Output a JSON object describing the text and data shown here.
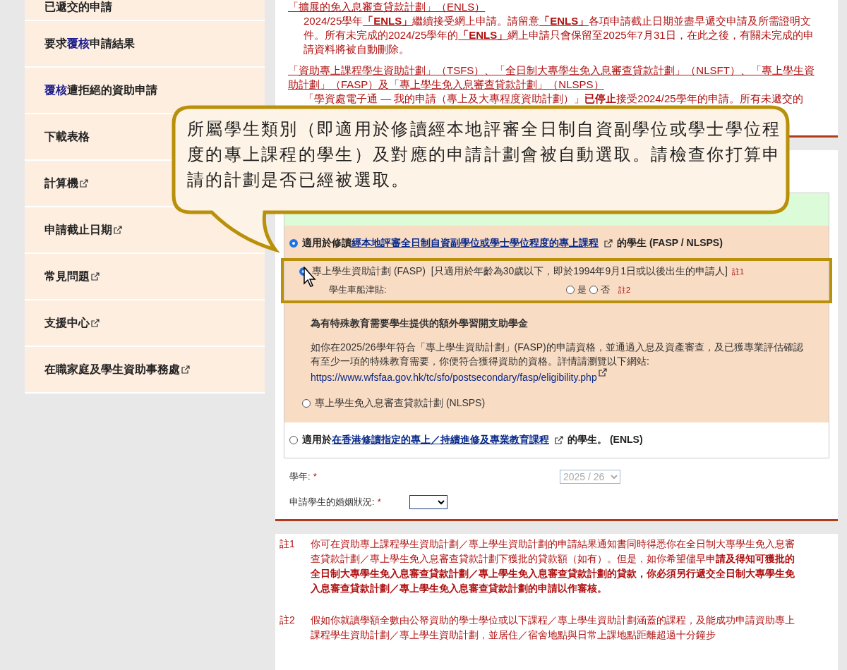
{
  "sidebar": {
    "items": [
      {
        "segments": [
          {
            "text": "已遞交的申請",
            "kind": "plain"
          }
        ],
        "external": false,
        "cut": true
      },
      {
        "segments": [
          {
            "text": "要求",
            "kind": "plain"
          },
          {
            "text": "覆核",
            "kind": "term"
          },
          {
            "text": "申請結果",
            "kind": "plain"
          }
        ],
        "external": false,
        "cut": false
      },
      {
        "segments": [
          {
            "text": "覆核",
            "kind": "term"
          },
          {
            "text": "遭拒絕的資助申請",
            "kind": "plain"
          }
        ],
        "external": false,
        "cut": false
      },
      {
        "segments": [
          {
            "text": "下載表格",
            "kind": "plain"
          }
        ],
        "external": false,
        "cut": false
      },
      {
        "segments": [
          {
            "text": "計算機",
            "kind": "plain"
          }
        ],
        "external": true,
        "cut": false
      },
      {
        "segments": [
          {
            "text": "申請截止日期",
            "kind": "plain"
          }
        ],
        "external": true,
        "cut": false
      },
      {
        "segments": [
          {
            "text": "常見問題",
            "kind": "plain"
          }
        ],
        "external": true,
        "cut": false
      },
      {
        "segments": [
          {
            "text": "支援中心",
            "kind": "plain"
          }
        ],
        "external": true,
        "cut": false
      },
      {
        "segments": [
          {
            "text": "在職家庭及學生資助事務處",
            "kind": "plain"
          }
        ],
        "external": true,
        "cut": false
      }
    ]
  },
  "notices": [
    {
      "heading": "「擴展的免入息審查貸款計劃」（ENLS）",
      "body": [
        {
          "text": "2024/25學年",
          "kind": "plain"
        },
        {
          "text": "「ENLS」",
          "kind": "link"
        },
        {
          "text": "繼續接受網上申請。請留意",
          "kind": "plain"
        },
        {
          "text": "「ENLS」",
          "kind": "link"
        },
        {
          "text": "各項申請截止日期並盡早遞交申請及所需證明文件。所有未完成的2024/25學年的",
          "kind": "plain"
        },
        {
          "text": "「ENLS」",
          "kind": "link"
        },
        {
          "text": "網上申請只會保留至2025年7月31日，在此之後，有關未完成的申請資料將被自動刪除。",
          "kind": "plain"
        }
      ]
    },
    {
      "heading": "「資助專上課程學生資助計劃」（TSFS）、「全日制大專學生免入息審查貸款計劃」（NLSFT）、「專上學生資助計劃」（FASP）及「專上學生免入息審查貸款計劃」（NLSPS）",
      "body": [
        {
          "text": "「學資處電子通 — 我的申請（專上及大專程度資助計劃）」",
          "kind": "plain"
        },
        {
          "text": "已停止",
          "kind": "bold"
        },
        {
          "text": "接受2024/25學年的申請。所有未遞交的",
          "kind": "plain"
        }
      ]
    }
  ],
  "callout": {
    "text": "所屬學生類別（即適用於修讀經本地評審全日制自資副學位或學士學位程度的專上課程的學生）及對應的申請計劃會被自動選取。請檢查你打算申請的計劃是否已經被選取。"
  },
  "categories": [
    {
      "selected": true,
      "prefix": "適用於修讀",
      "link": "經本地評審全日制自資副學位或學士學位程度的專上課程",
      "suffix": "的學生",
      "code": "(FASP / NLSPS)",
      "schemes": [
        {
          "selected": true,
          "highlighted": true,
          "label": "專上學生資助計劃 (FASP)",
          "condition": "[只適用於年齡為30歲以下，即於1994年9月1日或以後出生的申請人]",
          "note_mark": "註1",
          "subsidy": {
            "label": "學生車船津貼:",
            "choices": [
              {
                "label": "是",
                "selected": false
              },
              {
                "label": "否",
                "selected": false
              }
            ],
            "note_mark": "註2"
          },
          "extra": {
            "title": "為有特殊教育需要學生提供的額外學習開支助學金",
            "text": "如你在2025/26學年符合「專上學生資助計劃」(FASP)的申請資格，並通過入息及資產審查，及已獲專業評估確認有至少一項的特殊教育需要，你便符合獲得資助的資格。詳情請瀏覽以下網站:",
            "url": "https://www.wfsfaa.gov.hk/tc/sfo/postsecondary/fasp/eligibility.php"
          }
        },
        {
          "selected": false,
          "highlighted": false,
          "label": "專上學生免入息審查貸款計劃 (NLSPS)"
        }
      ]
    },
    {
      "selected": false,
      "prefix": "適用於",
      "link": "在香港修讀指定的專上／持續進修及專業教育課程",
      "suffix": "的學生。",
      "code": "(ENLS)"
    }
  ],
  "fields": [
    {
      "label": "學年:",
      "required_mark": "*",
      "kind": "select",
      "value": "2025 / 26",
      "disabled": true
    },
    {
      "label": "申請學生的婚姻狀況:",
      "required_mark": "*",
      "kind": "select",
      "disabled": false
    }
  ],
  "notes": [
    {
      "mark": "註1",
      "text": "你可在資助專上課程學生資助計劃／專上學生資助計劃的申請結果通知書同時得悉你在全日制大專學生免入息審查貸款計劃／專上學生免入息審查貸款計劃下獲批的貸款額（如有）。但是，如你希望儘早申**請及得知可獲批的全日制大專學生免入息審查貸款計劃／專上學生免入息審查貸款計劃的貸款，你必須另行遞交全日制大專學生免入息審查貸款計劃／專上學生免入息審查貸款計劃的申請以作審核。**"
    },
    {
      "mark": "註2",
      "text": "假如你就讀學額全數由公帑資助的學士學位或以下課程／專上學生資助計劃涵蓋的課程，及能成功申請資助專上課程學生資助計劃／專上學生資助計劃，並居住／宿舍地點與日常上課地點距離超過十分鐘步"
    }
  ]
}
